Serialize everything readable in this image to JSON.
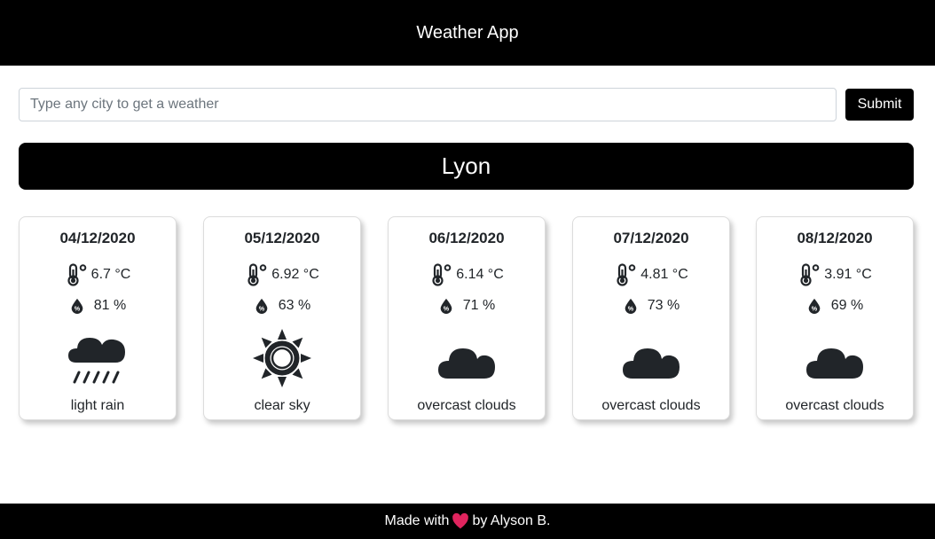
{
  "header": {
    "title": "Weather App"
  },
  "search": {
    "placeholder": "Type any city to get a weather",
    "value": "",
    "submit_label": "Submit"
  },
  "city": {
    "name": "Lyon"
  },
  "forecast": [
    {
      "date": "04/12/2020",
      "temp": "6.7 °C",
      "humidity": "81 %",
      "icon": "rain-icon",
      "description": "light rain"
    },
    {
      "date": "05/12/2020",
      "temp": "6.92 °C",
      "humidity": "63 %",
      "icon": "sun-icon",
      "description": "clear sky"
    },
    {
      "date": "06/12/2020",
      "temp": "6.14 °C",
      "humidity": "71 %",
      "icon": "cloud-icon",
      "description": "overcast clouds"
    },
    {
      "date": "07/12/2020",
      "temp": "4.81 °C",
      "humidity": "73 %",
      "icon": "cloud-icon",
      "description": "overcast clouds"
    },
    {
      "date": "08/12/2020",
      "temp": "3.91 °C",
      "humidity": "69 %",
      "icon": "cloud-icon",
      "description": "overcast clouds"
    }
  ],
  "footer": {
    "prefix": "Made with",
    "suffix": "by Alyson B.",
    "heart_icon": "heart-icon",
    "heart_color": "#e0245e"
  },
  "colors": {
    "header_bg": "#000000",
    "banner_bg": "#000000",
    "icon_color": "#212529"
  }
}
